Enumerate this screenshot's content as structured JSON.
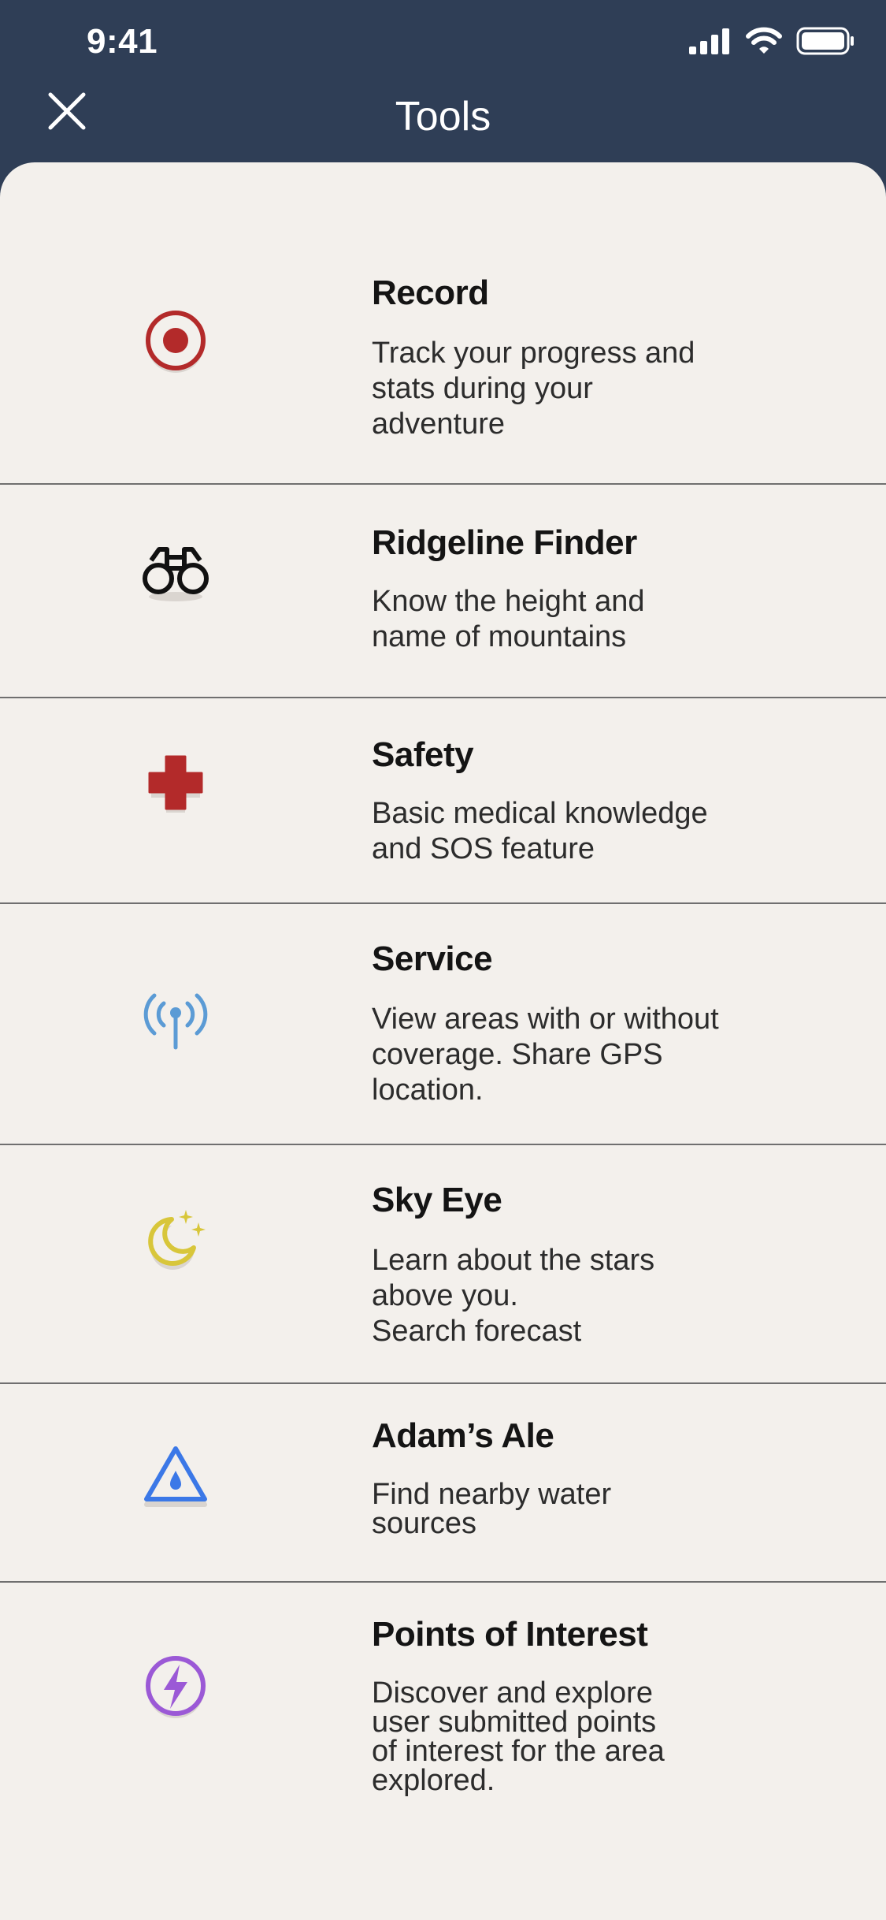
{
  "status_bar": {
    "time": "9:41"
  },
  "nav": {
    "title": "Tools",
    "close_icon": "close-icon"
  },
  "tools": [
    {
      "title": "Record",
      "description": "Track your progress and\nstats during your\nadventure",
      "icon": "record-icon",
      "color": "#b32a2a"
    },
    {
      "title": "Ridgeline Finder",
      "description": "Know the height and\nname of mountains",
      "icon": "binoculars-icon",
      "color": "#111111"
    },
    {
      "title": "Safety",
      "description": "Basic medical knowledge\nand SOS feature",
      "icon": "medical-cross-icon",
      "color": "#b32a2a"
    },
    {
      "title": "Service",
      "description": "View areas with or without\ncoverage. Share GPS\nlocation.",
      "icon": "antenna-signal-icon",
      "color": "#5b9bd5"
    },
    {
      "title": "Sky Eye",
      "description": "Learn about the stars\nabove you.\nSearch forecast",
      "icon": "moon-stars-icon",
      "color": "#d8c63a"
    },
    {
      "title": "Adam’s Ale",
      "description": "Find nearby water\nsources",
      "icon": "water-drop-triangle-icon",
      "color": "#3b78e7"
    },
    {
      "title": "Points of Interest",
      "description": "Discover and explore\nuser submitted points\nof interest for the area\nexplored.",
      "icon": "lightning-bolt-icon",
      "color": "#9b59d6"
    }
  ]
}
